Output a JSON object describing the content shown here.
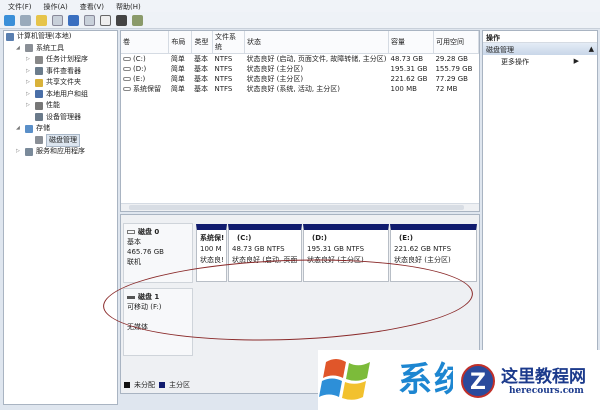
{
  "menu": [
    "文件(F)",
    "操作(A)",
    "查看(V)",
    "帮助(H)"
  ],
  "tree": [
    {
      "label": "计算机管理(本地)",
      "indent": 0,
      "color": "#5a7fb0"
    },
    {
      "label": "系统工具",
      "indent": 1,
      "color": "#8a8f96"
    },
    {
      "label": "任务计划程序",
      "indent": 2,
      "color": "#888"
    },
    {
      "label": "事件查看器",
      "indent": 2,
      "color": "#6b7c8c"
    },
    {
      "label": "共享文件夹",
      "indent": 2,
      "color": "#d9b23a"
    },
    {
      "label": "本地用户和组",
      "indent": 2,
      "color": "#4a6fa8"
    },
    {
      "label": "性能",
      "indent": 2,
      "color": "#777"
    },
    {
      "label": "设备管理器",
      "indent": 2,
      "color": "#6a7a8a"
    },
    {
      "label": "存储",
      "indent": 1,
      "color": "#5a8fc8"
    },
    {
      "label": "磁盘管理",
      "indent": 2,
      "color": "#8a8f96",
      "selected": true
    },
    {
      "label": "服务和应用程序",
      "indent": 1,
      "color": "#7a8a9a"
    }
  ],
  "volumes": {
    "headers": [
      "卷",
      "布局",
      "类型",
      "文件系统",
      "状态",
      "容量",
      "可用空间"
    ],
    "rows": [
      [
        "(C:)",
        "简单",
        "基本",
        "NTFS",
        "状态良好 (启动, 页面文件, 故障转储, 主分区)",
        "48.73 GB",
        "29.28 GB"
      ],
      [
        "(D:)",
        "简单",
        "基本",
        "NTFS",
        "状态良好 (主分区)",
        "195.31 GB",
        "155.79 GB"
      ],
      [
        "(E:)",
        "简单",
        "基本",
        "NTFS",
        "状态良好 (主分区)",
        "221.62 GB",
        "77.29 GB"
      ],
      [
        "系统保留",
        "简单",
        "基本",
        "NTFS",
        "状态良好 (系统, 活动, 主分区)",
        "100 MB",
        "72 MB"
      ]
    ]
  },
  "disk0": {
    "name": "磁盘 0",
    "type": "基本",
    "size": "465.76 GB",
    "status": "联机",
    "parts": [
      {
        "name": "系统保!",
        "size": "100 M",
        "status": "状态良!"
      },
      {
        "name": "(C:)",
        "size": "48.73 GB NTFS",
        "status": "状态良好 (启动, 页面"
      },
      {
        "name": "(D:)",
        "size": "195.31 GB NTFS",
        "status": "状态良好 (主分区)"
      },
      {
        "name": "(E:)",
        "size": "221.62 GB NTFS",
        "status": "状态良好 (主分区)"
      }
    ]
  },
  "disk1": {
    "name": "磁盘 1",
    "type": "可移动 (F:)",
    "status": "无媒体"
  },
  "legend": [
    {
      "label": "未分配",
      "color": "#111111"
    },
    {
      "label": "主分区",
      "color": "#101b6e"
    }
  ],
  "actions": {
    "header": "操作",
    "section": "磁盘管理",
    "item": "更多操作"
  },
  "watermark": {
    "logo1": "系统之家",
    "logo1_url": "www",
    "logo2": "这里教程网",
    "logo2_url": "herecours.com"
  }
}
